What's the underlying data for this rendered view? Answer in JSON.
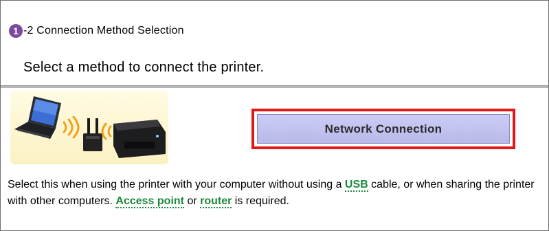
{
  "step": {
    "number": "1",
    "title": "-2 Connection Method Selection"
  },
  "instruction": "Select a method to connect the printer.",
  "option": {
    "button_label": "Network Connection",
    "description": {
      "part1": "Select this when using the printer with your computer without using a ",
      "term1": "USB",
      "part2": " cable, or when sharing the printer with other computers. ",
      "term2": "Access point",
      "part3": " or ",
      "term3": "router",
      "part4": " is required."
    }
  },
  "colors": {
    "step_badge": "#7b4a9c",
    "highlight_border": "#e01818",
    "button_fill": "#c4c4f0",
    "glossary_term": "#1b8a3a"
  },
  "icons": [
    "laptop-icon",
    "wifi-router-icon",
    "printer-icon",
    "wireless-signal-icon"
  ]
}
